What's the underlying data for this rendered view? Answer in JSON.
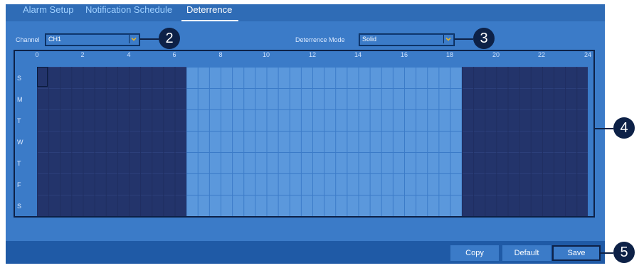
{
  "tabs": [
    {
      "label": "Alarm Setup",
      "active": false
    },
    {
      "label": "Notification Schedule",
      "active": false
    },
    {
      "label": "Deterrence",
      "active": true
    }
  ],
  "channel": {
    "label": "Channel",
    "value": "CH1"
  },
  "deterrence_mode": {
    "label": "Deterrence Mode",
    "value": "Solid"
  },
  "hours": [
    "0",
    "2",
    "4",
    "6",
    "8",
    "10",
    "12",
    "14",
    "16",
    "18",
    "20",
    "22",
    "24"
  ],
  "days": [
    "S",
    "M",
    "T",
    "W",
    "T",
    "F",
    "S"
  ],
  "schedule": {
    "active_ranges_hours": [
      [
        0,
        6.5
      ],
      [
        18.5,
        24
      ]
    ],
    "active_color": "#23346b",
    "inactive_color": "#5b98dc"
  },
  "callouts": [
    "2",
    "3",
    "4",
    "5"
  ],
  "buttons": {
    "copy": "Copy",
    "default": "Default",
    "save": "Save"
  },
  "icons": {
    "dropdown": "chevron-down-icon"
  }
}
